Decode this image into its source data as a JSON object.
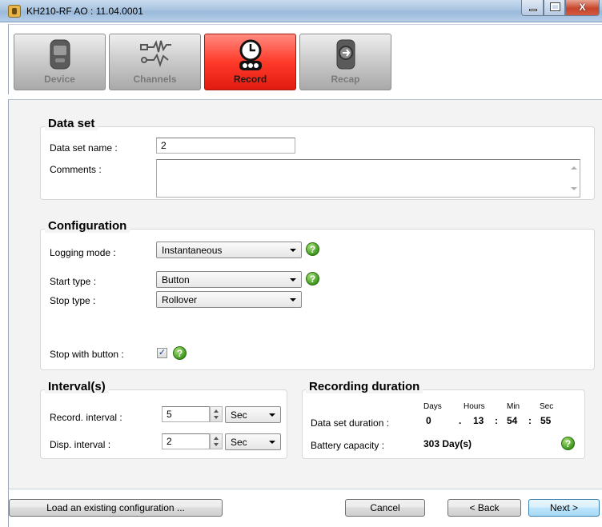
{
  "window": {
    "title": "KH210-RF AO : 11.04.0001"
  },
  "toolbar": {
    "tabs": [
      {
        "label": "Device",
        "icon": "device-icon"
      },
      {
        "label": "Channels",
        "icon": "channels-icon"
      },
      {
        "label": "Record",
        "icon": "clock-icon",
        "active": true
      },
      {
        "label": "Recap",
        "icon": "recap-icon"
      }
    ]
  },
  "data_set": {
    "title": "Data set",
    "name_label": "Data set name :",
    "name_value": "2",
    "comments_label": "Comments :",
    "comments_value": ""
  },
  "configuration": {
    "title": "Configuration",
    "logging_mode_label": "Logging mode :",
    "logging_mode_value": "Instantaneous",
    "start_type_label": "Start type :",
    "start_type_value": "Button",
    "stop_type_label": "Stop type :",
    "stop_type_value": "Rollover",
    "stop_with_button_label": "Stop with button :",
    "stop_with_button_checked": true,
    "check_mark": "✓"
  },
  "intervals": {
    "title": "Interval(s)",
    "record_label": "Record. interval :",
    "record_value": "5",
    "record_unit": "Sec",
    "disp_label": "Disp. interval :",
    "disp_value": "2",
    "disp_unit": "Sec"
  },
  "recording_duration": {
    "title": "Recording duration",
    "headers": {
      "days": "Days",
      "hours": "Hours",
      "min": "Min",
      "sec": "Sec"
    },
    "data_set_duration_label": "Data set duration :",
    "days": "0",
    "sep1": ".",
    "hours": "13",
    "sep2": ":",
    "min": "54",
    "sep3": ":",
    "sec": "55",
    "battery_label": "Battery capacity :",
    "battery_value": "303 Day(s)"
  },
  "help_glyph": "?",
  "buttons": {
    "load": "Load an existing configuration ...",
    "cancel": "Cancel",
    "back": "< Back",
    "next": "Next >"
  },
  "colors": {
    "active_tab": "#ff3b2a",
    "help_green": "#3f9a1f"
  }
}
